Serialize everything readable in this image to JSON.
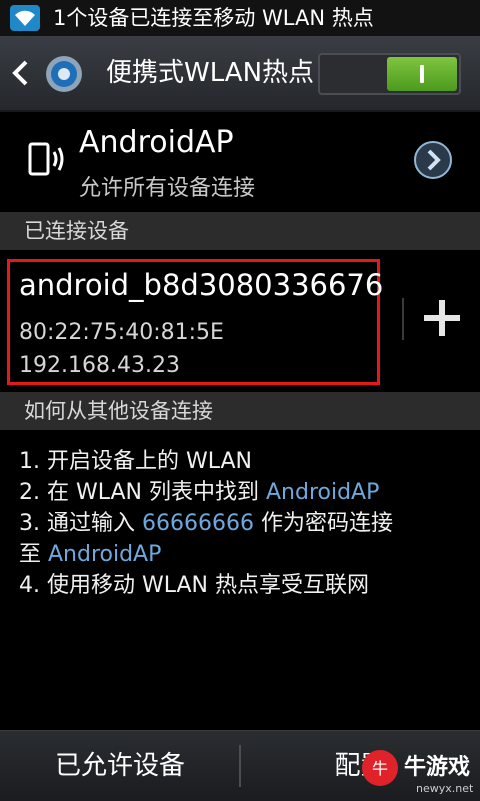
{
  "statusbar": {
    "text": "1个设备已连接至移动 WLAN 热点"
  },
  "actionbar": {
    "title": "便携式WLAN热点"
  },
  "ap": {
    "name": "AndroidAP",
    "subtitle": "允许所有设备连接"
  },
  "connected": {
    "header": "已连接设备",
    "device": {
      "name": "android_b8d3080336676",
      "mac": "80:22:75:40:81:5E",
      "ip": "192.168.43.23"
    }
  },
  "howto": {
    "header": "如何从其他设备连接",
    "line1": "1. 开启设备上的 WLAN",
    "line2_a": "2. 在 WLAN 列表中找到 ",
    "line2_link": "AndroidAP",
    "line3_a": "3. 通过输入 ",
    "line3_pw": "66666666",
    "line3_b": " 作为密码连接",
    "line3c_a": "至 ",
    "line3c_link": "AndroidAP",
    "line4": "4. 使用移动 WLAN 热点享受互联网"
  },
  "bottombar": {
    "allowed_devices": "已允许设备",
    "configure": "配置"
  },
  "watermark": {
    "brand": "牛游戏",
    "url": "newyx.net"
  },
  "colors": {
    "accent_green": "#6bb534",
    "highlight_red": "#e41a1a",
    "link_blue": "#6fa8dc"
  }
}
